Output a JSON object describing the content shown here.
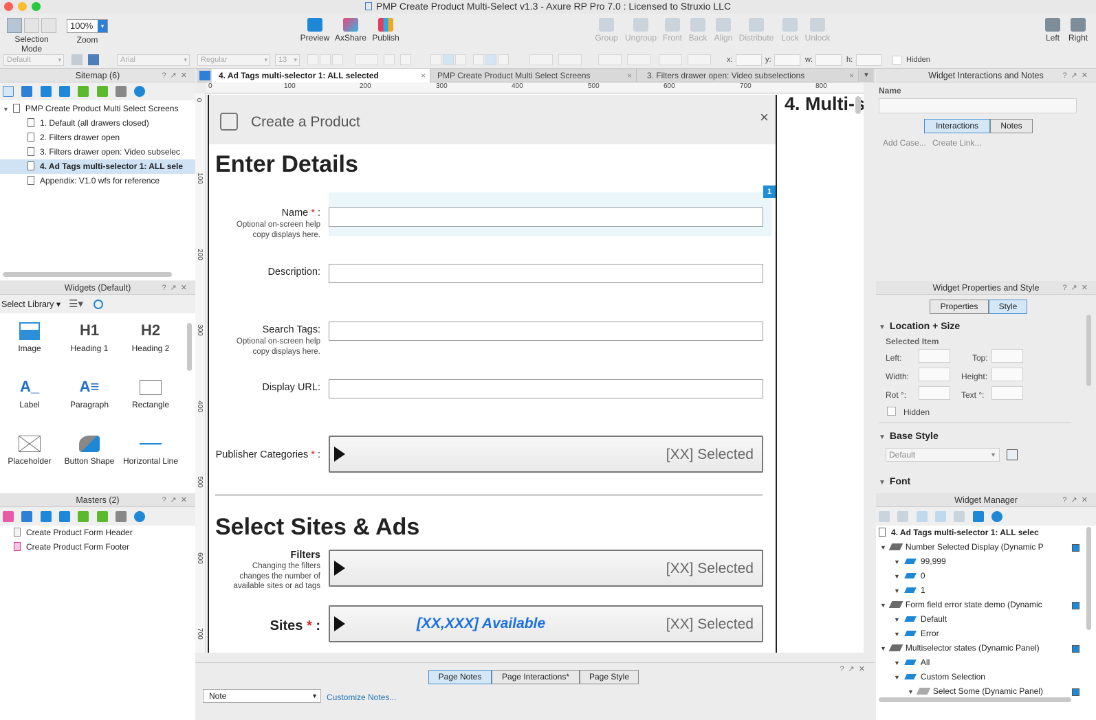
{
  "window": {
    "title": "PMP Create Product Multi-Select v1.3 - Axure RP Pro 7.0 : Licensed to Struxio LLC"
  },
  "toolbar": {
    "selection_mode": "Selection Mode",
    "zoom_label": "Zoom",
    "zoom_value": "100%",
    "preview": "Preview",
    "axshare": "AxShare",
    "publish": "Publish",
    "group": "Group",
    "ungroup": "Ungroup",
    "front": "Front",
    "back": "Back",
    "align": "Align",
    "distribute": "Distribute",
    "lock": "Lock",
    "unlock": "Unlock",
    "left": "Left",
    "right": "Right"
  },
  "formatbar": {
    "style": "Default",
    "font": "Arial",
    "weight": "Regular",
    "size": "13",
    "x_label": "x:",
    "y_label": "y:",
    "w_label": "w:",
    "h_label": "h:",
    "hidden_label": "Hidden"
  },
  "sitemap": {
    "title": "Sitemap (6)",
    "root": "PMP Create Product Multi Select Screens",
    "pages": [
      "1. Default (all drawers closed)",
      "2. Filters drawer open",
      "3. Filters drawer open: Video subselec",
      "4. Ad Tags multi-selector 1: ALL sele",
      "Appendix: V1.0 wfs for reference"
    ]
  },
  "widgets_panel": {
    "title": "Widgets (Default)",
    "select_library": "Select Library",
    "items": [
      {
        "glyph": "",
        "label": "Image"
      },
      {
        "glyph": "H1",
        "label": "Heading 1"
      },
      {
        "glyph": "H2",
        "label": "Heading 2"
      },
      {
        "glyph": "A_",
        "label": "Label"
      },
      {
        "glyph": "A≡",
        "label": "Paragraph"
      },
      {
        "glyph": "",
        "label": "Rectangle"
      },
      {
        "glyph": "",
        "label": "Placeholder"
      },
      {
        "glyph": "",
        "label": "Button Shape"
      },
      {
        "glyph": "",
        "label": "Horizontal Line"
      }
    ]
  },
  "masters": {
    "title": "Masters (2)",
    "items": [
      "Create Product Form Header",
      "Create Product Form Footer"
    ]
  },
  "tabs": [
    {
      "label": "4. Ad Tags multi-selector 1: ALL selected",
      "close": "×"
    },
    {
      "label": "PMP Create Product Multi Select Screens",
      "close": "×"
    },
    {
      "label": "3. Filters drawer open: Video subselections",
      "close": "×"
    }
  ],
  "ruler": {
    "top": [
      "0",
      "100",
      "200",
      "300",
      "400",
      "500",
      "600",
      "700",
      "800"
    ],
    "left": [
      "0",
      "100",
      "200",
      "300",
      "400",
      "500",
      "600",
      "700"
    ]
  },
  "canvas": {
    "header_title": "Create a Product",
    "close": "×",
    "side_title": "4. Multi-s",
    "enter_details": "Enter Details",
    "badge": "1",
    "name_label": "Name",
    "asterisk": "*",
    "colon": ":",
    "help_text": "Optional on-screen help copy displays here.",
    "description_label": "Description:",
    "search_tags_label": "Search Tags:",
    "display_url_label": "Display URL:",
    "publisher_categories_label": "Publisher Categories",
    "selected_text": "[XX] Selected",
    "select_sites": "Select Sites & Ads",
    "filters_label": "Filters",
    "filters_help": "Changing the filters changes the number of available sites or ad tags",
    "sites_label": "Sites",
    "available_text": "[XX,XXX] Available"
  },
  "bottom": {
    "page_notes": "Page Notes",
    "page_interactions": "Page Interactions",
    "page_style": "Page Style",
    "note_select": "Note",
    "customize": "Customize Notes..."
  },
  "interactions_panel": {
    "title": "Widget Interactions and Notes",
    "name_label": "Name",
    "tab_interactions": "Interactions",
    "tab_notes": "Notes",
    "add_case": "Add Case...",
    "create_link": "Create Link..."
  },
  "properties_panel": {
    "title": "Widget Properties and Style",
    "tab_properties": "Properties",
    "tab_style": "Style",
    "location_size": "Location + Size",
    "selected_item": "Selected Item",
    "left": "Left:",
    "top": "Top:",
    "width": "Width:",
    "height": "Height:",
    "rot": "Rot °:",
    "text": "Text °:",
    "hidden": "Hidden",
    "base_style": "Base Style",
    "base_default": "Default",
    "font": "Font"
  },
  "widget_manager": {
    "title": "Widget Manager",
    "page": "4. Ad Tags multi-selector 1: ALL selec",
    "rows": [
      {
        "label": "Number Selected Display (Dynamic P",
        "kind": "panel",
        "level": 0
      },
      {
        "label": "99,999",
        "kind": "state",
        "level": 1
      },
      {
        "label": "0",
        "kind": "state",
        "level": 1
      },
      {
        "label": "1",
        "kind": "state",
        "level": 1
      },
      {
        "label": "Form field error state demo (Dynamic",
        "kind": "panel",
        "level": 0
      },
      {
        "label": "Default",
        "kind": "state",
        "level": 1
      },
      {
        "label": "Error",
        "kind": "state",
        "level": 1
      },
      {
        "label": "Multiselector states (Dynamic Panel)",
        "kind": "panel",
        "level": 0
      },
      {
        "label": "All",
        "kind": "state",
        "level": 1
      },
      {
        "label": "Custom Selection",
        "kind": "state",
        "level": 1
      },
      {
        "label": "Select Some (Dynamic Panel)",
        "kind": "panel",
        "level": 2
      }
    ]
  },
  "colors": {
    "accent": "#1e88d8",
    "required": "#e02020",
    "available": "#1a6fe0",
    "badge": "#1e8fd6"
  }
}
